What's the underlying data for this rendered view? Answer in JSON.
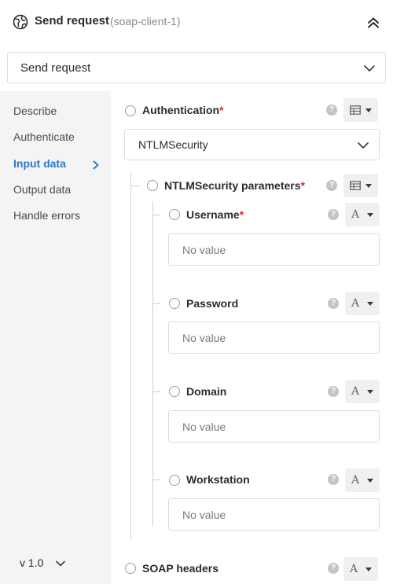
{
  "header": {
    "title": "Send request",
    "subtitle": "(soap-client-1)",
    "app_icon": "globe-icon",
    "collapse_icon": "double-chevron-up-icon"
  },
  "top_select": {
    "value": "Send request"
  },
  "sidebar": {
    "items": [
      {
        "label": "Describe"
      },
      {
        "label": "Authenticate"
      },
      {
        "label": "Input data",
        "active": true
      },
      {
        "label": "Output data"
      },
      {
        "label": "Handle errors"
      }
    ],
    "version": "v 1.0",
    "active_color": "#2b78d0"
  },
  "main": {
    "authentication": {
      "label": "Authentication",
      "required": "*",
      "value": "NTLMSecurity"
    },
    "ntlm": {
      "label": "NTLMSecurity parameters",
      "required": "*",
      "fields": [
        {
          "label": "Username",
          "required": "*",
          "placeholder": "No value"
        },
        {
          "label": "Password",
          "required": "",
          "placeholder": "No value"
        },
        {
          "label": "Domain",
          "required": "",
          "placeholder": "No value"
        },
        {
          "label": "Workstation",
          "required": "",
          "placeholder": "No value"
        }
      ]
    },
    "soap_headers": {
      "label": "SOAP headers"
    },
    "help_glyph": "?",
    "text_type_glyph": "A"
  }
}
